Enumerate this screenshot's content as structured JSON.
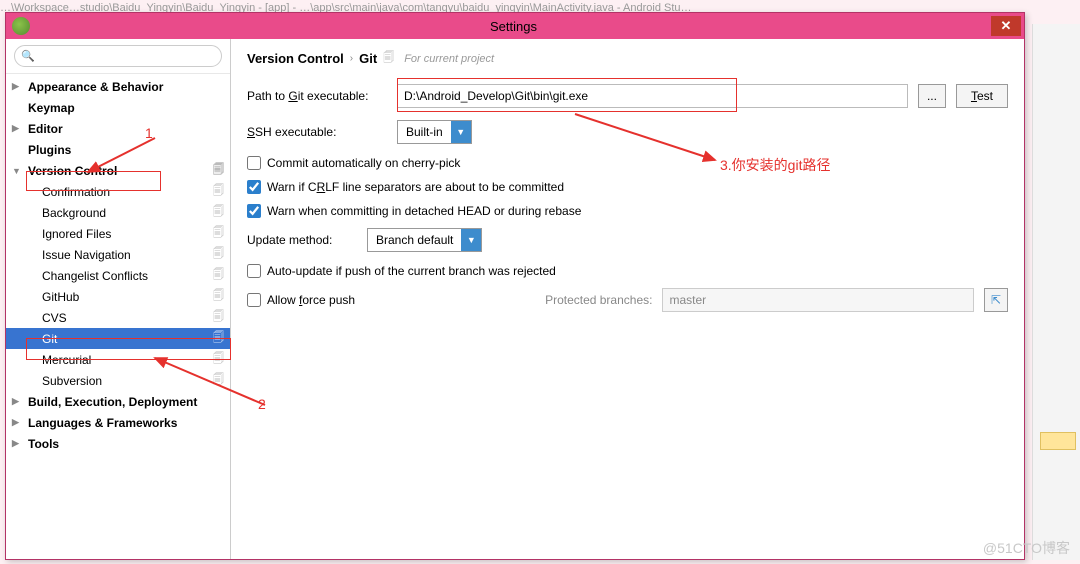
{
  "bg_titlebar": "…\\Workspace…studio\\Baidu_Yingyin\\Baidu_Yingyin - [app] - …\\app\\src\\main\\java\\com\\tangyu\\baidu_yingyin\\MainActivity.java - Android Stu…",
  "dialog": {
    "title": "Settings"
  },
  "search": {
    "placeholder": ""
  },
  "sidebar": {
    "items": [
      {
        "label": "Appearance & Behavior",
        "bold": true,
        "level": 0,
        "expander": "▶"
      },
      {
        "label": "Keymap",
        "bold": true,
        "level": 0
      },
      {
        "label": "Editor",
        "bold": true,
        "level": 0,
        "expander": "▶"
      },
      {
        "label": "Plugins",
        "bold": true,
        "level": 0
      },
      {
        "label": "Version Control",
        "bold": true,
        "level": 0,
        "expander": "▼",
        "copy": true,
        "hl": true
      },
      {
        "label": "Confirmation",
        "level": 1,
        "copy": true
      },
      {
        "label": "Background",
        "level": 1,
        "copy": true
      },
      {
        "label": "Ignored Files",
        "level": 1,
        "copy": true
      },
      {
        "label": "Issue Navigation",
        "level": 1,
        "copy": true
      },
      {
        "label": "Changelist Conflicts",
        "level": 1,
        "copy": true
      },
      {
        "label": "GitHub",
        "level": 1,
        "copy": true
      },
      {
        "label": "CVS",
        "level": 1,
        "copy": true
      },
      {
        "label": "Git",
        "level": 1,
        "copy": true,
        "selected": true,
        "hl": true
      },
      {
        "label": "Mercurial",
        "level": 1,
        "copy": true
      },
      {
        "label": "Subversion",
        "level": 1,
        "copy": true
      },
      {
        "label": "Build, Execution, Deployment",
        "bold": true,
        "level": 0,
        "expander": "▶"
      },
      {
        "label": "Languages & Frameworks",
        "bold": true,
        "level": 0,
        "expander": "▶"
      },
      {
        "label": "Tools",
        "bold": true,
        "level": 0,
        "expander": "▶"
      }
    ]
  },
  "breadcrumb": {
    "a": "Version Control",
    "b": "Git",
    "hint": "For current project"
  },
  "form": {
    "path_label": "Path to Git executable:",
    "path_value": "D:\\Android_Develop\\Git\\bin\\git.exe",
    "browse": "...",
    "test": "Test",
    "ssh_label": "SSH executable:",
    "ssh_value": "Built-in",
    "cb_cherry": "Commit automatically on cherry-pick",
    "cb_crlf": "Warn if CRLF line separators are about to be committed",
    "cb_head": "Warn when committing in detached HEAD or during rebase",
    "update_label": "Update method:",
    "update_value": "Branch default",
    "cb_autoupdate": "Auto-update if push of the current branch was rejected",
    "cb_force": "Allow force push",
    "protected_label": "Protected branches:",
    "protected_value": "master"
  },
  "annotations": {
    "n1": "1",
    "n2": "2",
    "n3": "3.你安装的git路径"
  },
  "watermark": "@51CTO博客"
}
